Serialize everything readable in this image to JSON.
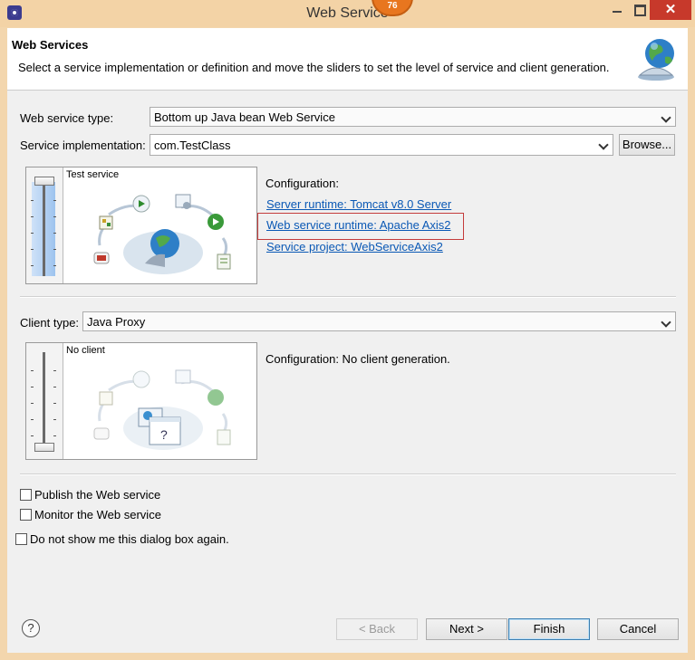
{
  "window": {
    "title": "Web Service",
    "badge": "76",
    "close_glyph": "✕"
  },
  "header": {
    "title": "Web Services",
    "description": "Select a service implementation or definition and move the sliders to set the level of service and client generation.",
    "icon": "globe-service-icon"
  },
  "service": {
    "type_label": "Web service type:",
    "type_value": "Bottom up Java bean Web Service",
    "impl_label": "Service implementation:",
    "impl_value": "com.TestClass",
    "browse_label": "Browse...",
    "level_label": "Test service",
    "slider_level": "Test service",
    "config_heading": "Configuration:",
    "links": {
      "server_runtime": "Server runtime: Tomcat v8.0 Server",
      "ws_runtime": "Web service runtime: Apache Axis2",
      "service_project": "Service project: WebServiceAxis2"
    }
  },
  "client": {
    "type_label": "Client type:",
    "type_value": "Java Proxy",
    "level_label": "No client",
    "config_text": "Configuration: No client generation."
  },
  "options": {
    "publish": {
      "label": "Publish the Web service",
      "checked": false
    },
    "monitor": {
      "label": "Monitor the Web service",
      "checked": false
    },
    "dont_show": {
      "label": "Do not show me this dialog box again.",
      "checked": false
    }
  },
  "footer": {
    "help_glyph": "?",
    "back": "< Back",
    "next": "Next >",
    "finish": "Finish",
    "cancel": "Cancel"
  },
  "colors": {
    "link": "#0a58b5",
    "highlight_border": "#c43b3b",
    "title_bar": "#f3d3a6",
    "close_button": "#c7392b"
  }
}
